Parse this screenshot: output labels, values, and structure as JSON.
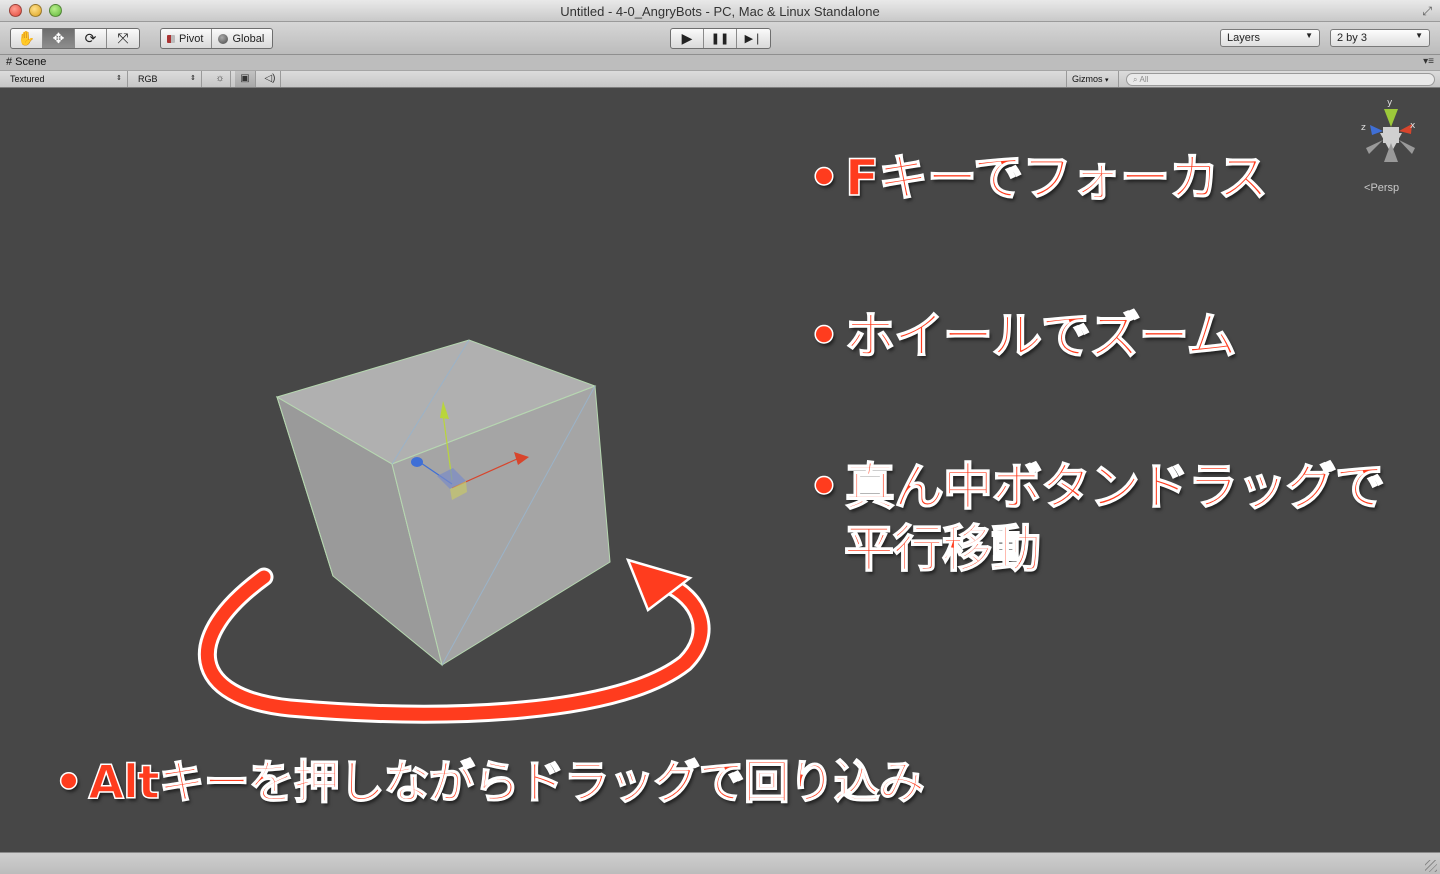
{
  "window": {
    "title": "Untitled - 4-0_AngryBots - PC, Mac & Linux Standalone"
  },
  "toolbar": {
    "tools": [
      {
        "name": "hand",
        "icon": "hand-icon",
        "glyph": "✋",
        "active": false
      },
      {
        "name": "move",
        "icon": "move-icon",
        "glyph": "✥",
        "active": true
      },
      {
        "name": "rotate",
        "icon": "rotate-icon",
        "glyph": "⟳",
        "active": false
      },
      {
        "name": "scale",
        "icon": "scale-icon",
        "glyph": "⤧",
        "active": false
      }
    ],
    "pivot_label": "Pivot",
    "global_label": "Global",
    "play_glyph": "▶",
    "pause_glyph": "❚❚",
    "step_glyph": "▶❘",
    "layers_label": "Layers",
    "layout_label": "2 by 3"
  },
  "scene_tab": {
    "label": "Scene",
    "icon": "grid-icon"
  },
  "scene_toolbar": {
    "render_mode": "Textured",
    "color_mode": "RGB",
    "gizmos_label": "Gizmos",
    "search_placeholder": "All"
  },
  "viewport": {
    "orientation_label": "Persp",
    "axis_labels": {
      "x": "x",
      "y": "y",
      "z": "z"
    },
    "axis_colors": {
      "x": "#d8452c",
      "y": "#9cc93a",
      "z": "#3f6fd6"
    },
    "annotation_color": "#ff3c1e"
  },
  "annotations": {
    "focus": "Fキーでフォーカス",
    "zoom": "ホイールでズーム",
    "pan_line1": "真ん中ボタンドラッグで",
    "pan_line2": "平行移動",
    "orbit": "Altキーを押しながらドラッグで回り込み",
    "bullet": "•"
  }
}
